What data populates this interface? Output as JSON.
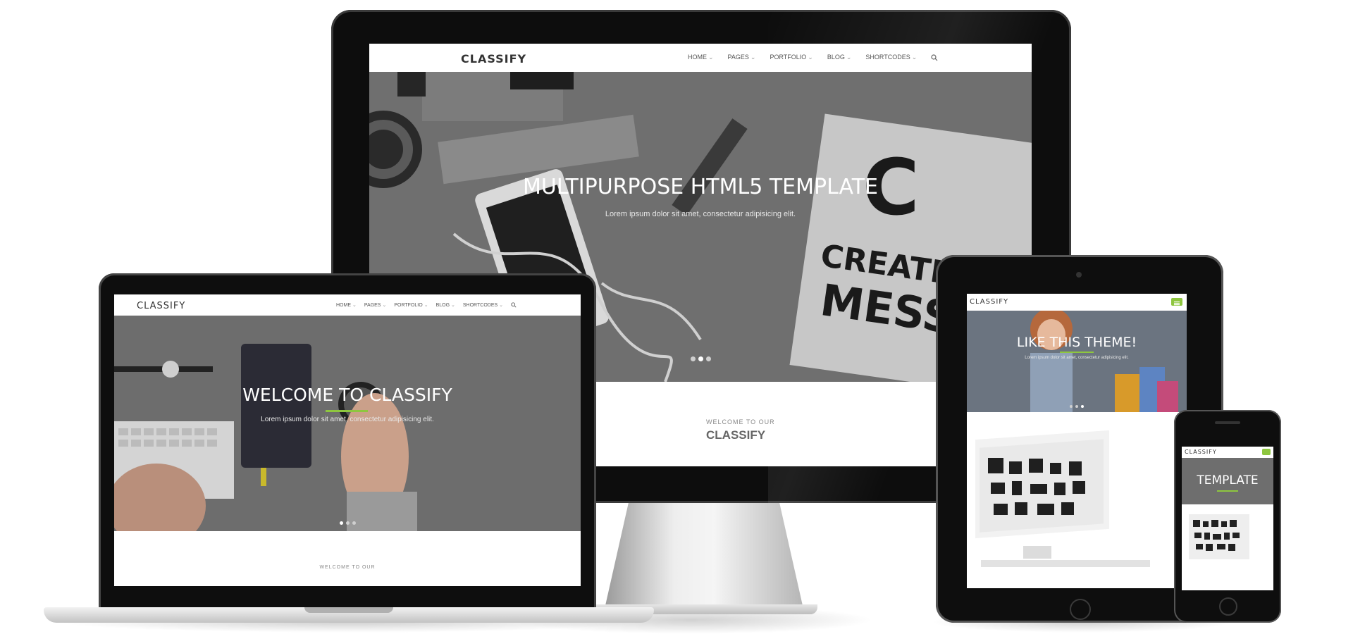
{
  "colors": {
    "accent": "#8ec63f",
    "bezel": "#0e0e0e",
    "hero_overlay": "#6e6e6e",
    "silver": "#d7d7d7"
  },
  "monitor": {
    "logo": "CLASSIFY",
    "nav": [
      {
        "label": "HOME"
      },
      {
        "label": "PAGES"
      },
      {
        "label": "PORTFOLIO"
      },
      {
        "label": "BLOG"
      },
      {
        "label": "SHORTCODES"
      }
    ],
    "hero_title": "MULTIPURPOSE HTML5 TEMPLATE",
    "hero_subtitle": "Lorem ipsum dolor sit amet, consectetur adipisicing elit.",
    "photo_text_letter": "C",
    "photo_text_creative": "CREATIV",
    "photo_text_mess": "MESS",
    "welcome_small": "WELCOME TO OUR",
    "welcome_big": "CLASSIFY",
    "slider_dots": 3,
    "active_dot": 1
  },
  "laptop": {
    "logo": "CLASSIFY",
    "nav": [
      {
        "label": "HOME"
      },
      {
        "label": "PAGES"
      },
      {
        "label": "PORTFOLIO"
      },
      {
        "label": "BLOG"
      },
      {
        "label": "SHORTCODES"
      }
    ],
    "hero_title": "WELCOME TO CLASSIFY",
    "hero_subtitle": "Lorem ipsum dolor sit amet, consectetur adipisicing elit.",
    "welcome_small": "WELCOME TO OUR",
    "slider_dots": 3,
    "active_dot": 0
  },
  "tablet": {
    "logo": "CLASSIFY",
    "menu_icon": "menu-icon",
    "hero_title": "LIKE THIS THEME!",
    "hero_subtitle": "Lorem ipsum dolor sit amet, consectetur adipisicing elit.",
    "slider_dots": 3,
    "active_dot": 2
  },
  "phone": {
    "logo": "CLASSIFY",
    "menu_icon": "menu-icon",
    "hero_title": "TEMPLATE"
  }
}
